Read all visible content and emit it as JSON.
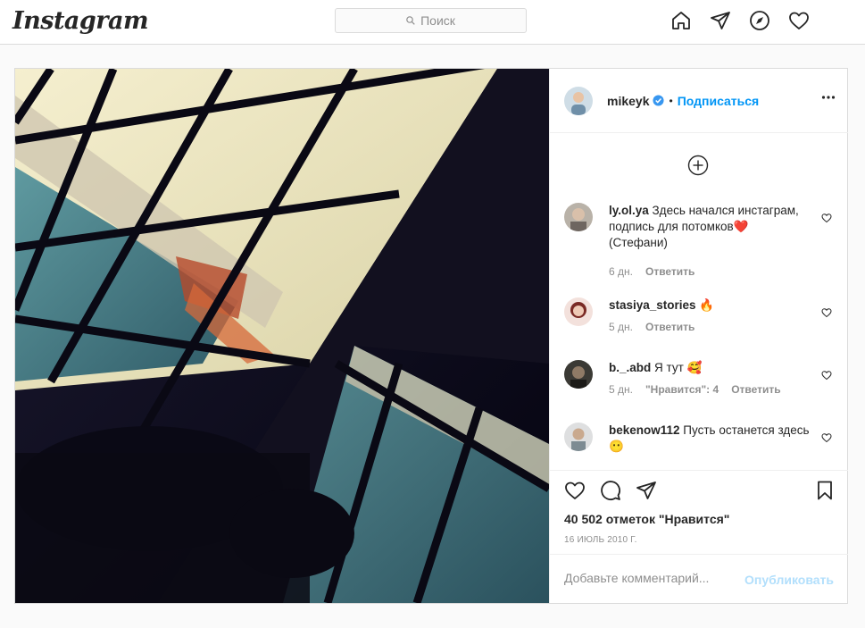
{
  "header": {
    "logo": "Instagram",
    "search_placeholder": "Поиск",
    "nav_icons": [
      "home-icon",
      "direct-icon",
      "explore-icon",
      "activity-icon"
    ]
  },
  "post": {
    "author": "mikeyk",
    "verified": true,
    "follow_label": "Подписаться",
    "separator": "•",
    "more_icon": "more-icon",
    "comments": [
      {
        "user": "ly.ol.ya",
        "text": " Здесь начался инстаграм, подпись для потомков",
        "emoji": "❤️",
        "text_after": " (Стефани)",
        "time": "6 дн.",
        "likes": "",
        "reply": "Ответить"
      },
      {
        "user": "stasiya_stories",
        "text": "",
        "emoji": "🔥",
        "text_after": "",
        "time": "5 дн.",
        "likes": "",
        "reply": "Ответить"
      },
      {
        "user": "b._.abd",
        "text": " Я тут",
        "emoji": "🥰",
        "text_after": "",
        "time": "5 дн.",
        "likes": "\"Нравится\": 4",
        "reply": "Ответить"
      },
      {
        "user": "bekenow112",
        "text": " Пусть останется здесь",
        "emoji": "😶",
        "text_after": "",
        "time": "",
        "likes": "",
        "reply": ""
      }
    ],
    "likes_count": "40 502 отметок \"Нравится\"",
    "date": "16 ИЮЛЬ 2010 Г.",
    "comment_placeholder": "Добавьте комментарий...",
    "publish_label": "Опубликовать",
    "colors": {
      "accent": "#0095f6",
      "border": "#dbdbdb",
      "muted": "#8e8e8e",
      "publish_disabled": "#b2dffc",
      "emoji_heart": "#e0245e"
    }
  }
}
